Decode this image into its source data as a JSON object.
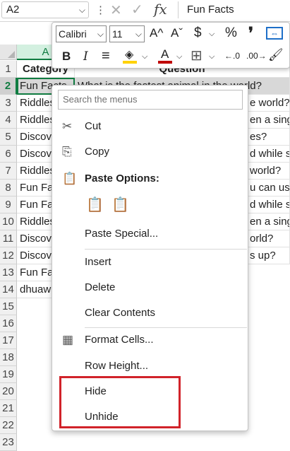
{
  "formula_bar": {
    "name_box": "A2",
    "name_box_arrow": "⌵",
    "more_icon": "⋮",
    "cancel_icon": "✕",
    "enter_icon": "✓",
    "function_icon": "fx",
    "formula_value": "Fun Facts"
  },
  "columns": [
    "A"
  ],
  "rows": [
    "1",
    "2",
    "3",
    "4",
    "5",
    "6",
    "7",
    "8",
    "9",
    "10",
    "11",
    "12",
    "13",
    "14",
    "15",
    "16",
    "17",
    "18",
    "19",
    "20",
    "21",
    "22",
    "23"
  ],
  "col_a": [
    "Category",
    "Fun Facts",
    "Riddles",
    "Riddles",
    "Discovery",
    "Discovery",
    "Riddles",
    "Fun Facts",
    "Fun Facts",
    "Riddles",
    "Discovery",
    "Discovery",
    "Fun Facts",
    "dhuaw"
  ],
  "col_b": [
    "Question",
    "What is the fastest animal in the world?",
    "e world?",
    "en a sing",
    "es?",
    "d while st",
    "world?",
    "u can use",
    "d while st",
    "en a sing",
    "orld?",
    "s up?",
    "",
    ""
  ],
  "mini_toolbar": {
    "font_name": "Calibri",
    "font_size": "11",
    "grow_font": "A^",
    "shrink_font": "Aˇ",
    "currency": "$",
    "percent": "%",
    "comma": "❜",
    "bold": "B",
    "italic": "I",
    "align": "≡",
    "fill_icon": "◈",
    "font_color_icon": "A",
    "borders_icon": "⊞",
    "inc_decimal": "←.0",
    "dec_decimal": ".00→",
    "format_painter_icon": "🖌",
    "dropdown_arrow": "⌵"
  },
  "context_menu": {
    "search_placeholder": "Search the menus",
    "items": {
      "cut": "Cut",
      "copy": "Copy",
      "paste_options": "Paste Options:",
      "paste_special": "Paste Special...",
      "insert": "Insert",
      "delete": "Delete",
      "clear_contents": "Clear Contents",
      "format_cells": "Format Cells...",
      "row_height": "Row Height...",
      "hide": "Hide",
      "unhide": "Unhide"
    },
    "icons": {
      "cut": "✂",
      "copy": "⎘",
      "paste": "📋",
      "format_cells": "▦"
    }
  },
  "colors": {
    "excel_green": "#107c41",
    "highlight_red": "#d1232a",
    "fill_yellow": "#ffd200",
    "font_red": "#c00000"
  }
}
